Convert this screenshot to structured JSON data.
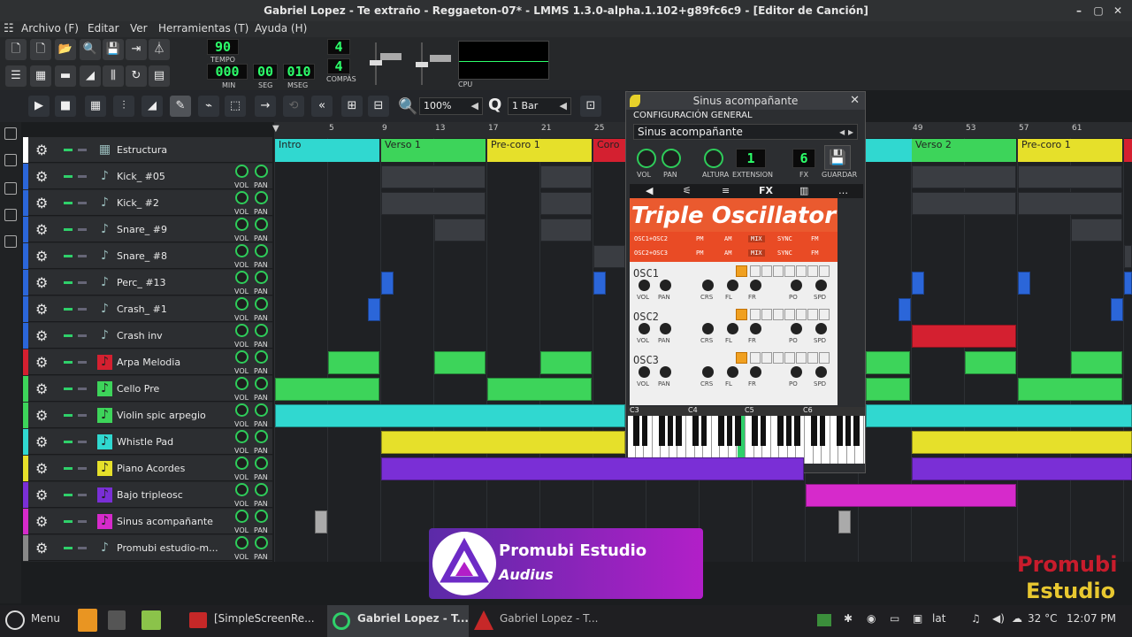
{
  "window": {
    "title": "Gabriel Lopez - Te extraño - Reggaeton-07* - LMMS 1.3.0-alpha.1.102+g89fc6c9 - [Editor de Canción]"
  },
  "menu": [
    "Archivo (F)",
    "Editar",
    "Ver",
    "Herramientas (T)",
    "Ayuda (H)"
  ],
  "transport": {
    "tempo": "90",
    "tempo_label": "TEMPO",
    "min": "000",
    "min_label": "MIN",
    "seg": "00",
    "seg_label": "SEG",
    "mseg": "010",
    "mseg_label": "MSEG",
    "compas_top": "4",
    "compas_bottom": "4",
    "compas_label": "COMPÁS",
    "cpu_label": "CPU"
  },
  "songbar": {
    "zoom": "100%",
    "quantize": "1 Bar"
  },
  "tracks": [
    {
      "name": "Estructura",
      "color": "#ffffff",
      "type": "structure"
    },
    {
      "name": "Kick_ #05",
      "color": "#2b66d9",
      "type": "audio"
    },
    {
      "name": "Kick_ #2",
      "color": "#2b66d9",
      "type": "audio"
    },
    {
      "name": "Snare_ #9",
      "color": "#2b66d9",
      "type": "audio"
    },
    {
      "name": "Snare_ #8",
      "color": "#2b66d9",
      "type": "audio"
    },
    {
      "name": "Perc_ #13",
      "color": "#2b66d9",
      "type": "audio"
    },
    {
      "name": "Crash_ #1",
      "color": "#2b66d9",
      "type": "audio"
    },
    {
      "name": "Crash inv",
      "color": "#2b66d9",
      "type": "audio"
    },
    {
      "name": "Arpa Melodia",
      "color": "#d42030",
      "type": "synth"
    },
    {
      "name": "Cello Pre",
      "color": "#3dd45a",
      "type": "synth"
    },
    {
      "name": "Violin spic arpegio",
      "color": "#3dd45a",
      "type": "synth"
    },
    {
      "name": "Whistle Pad",
      "color": "#30d8d0",
      "type": "synth"
    },
    {
      "name": "Piano Acordes",
      "color": "#e6e02a",
      "type": "synth"
    },
    {
      "name": "Bajo tripleosc",
      "color": "#7a2fd6",
      "type": "synth"
    },
    {
      "name": "Sinus acompañante",
      "color": "#d62acb",
      "type": "synth"
    },
    {
      "name": "Promubi estudio-m...",
      "color": "#888888",
      "type": "audio"
    }
  ],
  "knob_labels": {
    "vol": "VOL",
    "pan": "PAN"
  },
  "ruler": [
    "5",
    "9",
    "13",
    "17",
    "21",
    "25",
    "49",
    "53",
    "57",
    "61"
  ],
  "segments": [
    {
      "label": "Intro",
      "color": "#30d8d0"
    },
    {
      "label": "Verso 1",
      "color": "#3dd45a"
    },
    {
      "label": "Pre-coro 1",
      "color": "#e6e02a"
    },
    {
      "label": "Coro",
      "color": "#d42030"
    },
    {
      "label": "Verso 2",
      "color": "#3dd45a"
    },
    {
      "label": "Pre-coro 1",
      "color": "#e6e02a"
    }
  ],
  "plugin": {
    "title": "Sinus acompañante",
    "section": "CONFIGURACIÓN GENERAL",
    "name": "Sinus acompañante",
    "labels": [
      "VOL",
      "PAN",
      "ALTURA",
      "EXTENSION",
      "FX",
      "GUARDAR"
    ],
    "fx_num": "6",
    "ext_num": "1",
    "tabs": [
      "◀",
      "⚟",
      "≡",
      "FX",
      "▥",
      "…"
    ],
    "synth_title": "Triple Oscillator",
    "mode_rows": [
      [
        "OSC1+OSC2",
        "PM",
        "AM",
        "MIX",
        "SYNC",
        "FM"
      ],
      [
        "OSC2+OSC3",
        "PM",
        "AM",
        "MIX",
        "SYNC",
        "FM"
      ]
    ],
    "oscs": [
      "OSC1",
      "OSC2",
      "OSC3"
    ],
    "osc_knob_labels": [
      "VOL",
      "PAN",
      "CRS",
      "FL",
      "FR",
      "PO",
      "SPD"
    ],
    "octaves": [
      "C3",
      "C4",
      "C5",
      "C6"
    ]
  },
  "banner": {
    "title": "Promubi Estudio",
    "sub": "Audius"
  },
  "watermark": {
    "line1": "Promubi",
    "line2": "Estudio"
  },
  "taskbar": {
    "menu": "Menu",
    "tasks": [
      "[SimpleScreenRe...",
      "Gabriel Lopez - T...",
      "Gabriel Lopez - T..."
    ],
    "tray": {
      "kbd": "lat",
      "temp": "32 °C",
      "time": "12:07 PM"
    }
  }
}
